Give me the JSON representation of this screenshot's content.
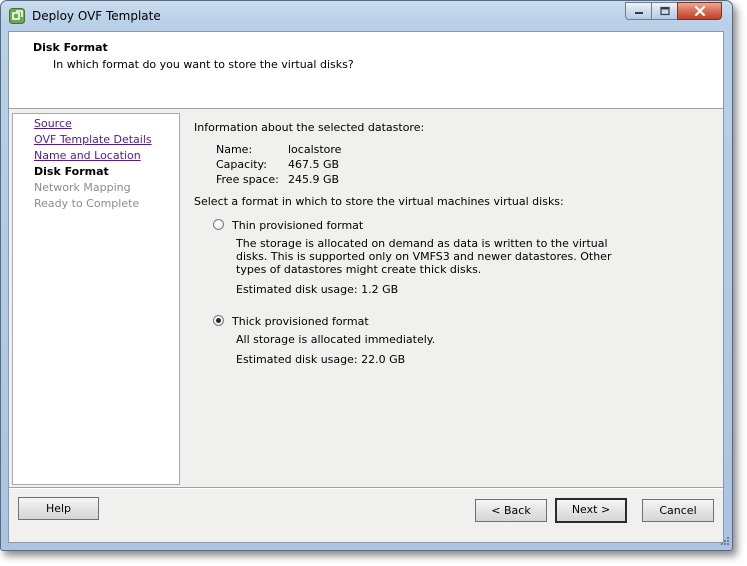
{
  "window": {
    "title": "Deploy OVF Template",
    "icon": "ovf-template-icon",
    "controls": [
      "minimize-icon",
      "maximize-icon",
      "close-icon"
    ]
  },
  "header": {
    "title": "Disk Format",
    "subtitle": "In which format do you want to store the virtual disks?"
  },
  "nav": {
    "items": [
      {
        "label": "Source",
        "state": "visited"
      },
      {
        "label": "OVF Template Details",
        "state": "visited"
      },
      {
        "label": "Name and Location",
        "state": "visited"
      },
      {
        "label": "Disk Format",
        "state": "current"
      },
      {
        "label": "Network Mapping",
        "state": "disabled"
      },
      {
        "label": "Ready to Complete",
        "state": "disabled"
      }
    ]
  },
  "datastore": {
    "heading": "Information about the selected datastore:",
    "name_label": "Name:",
    "name_value": "localstore",
    "capacity_label": "Capacity:",
    "capacity_value": "467.5 GB",
    "free_label": "Free space:",
    "free_value": "245.9 GB"
  },
  "format": {
    "prompt": "Select a format in which to store the virtual machines virtual disks:",
    "options": [
      {
        "label": "Thin provisioned format",
        "selected": false,
        "description": "The storage is allocated on demand as data is written to the virtual disks. This is supported only on VMFS3 and newer datastores. Other types of datastores might create thick disks.",
        "usage": "Estimated disk usage: 1.2 GB"
      },
      {
        "label": "Thick provisioned format",
        "selected": true,
        "description": "All storage is allocated immediately.",
        "usage": "Estimated disk usage: 22.0 GB"
      }
    ]
  },
  "buttons": {
    "help": "Help",
    "back": "< Back",
    "next": "Next >",
    "cancel": "Cancel"
  },
  "colors": {
    "link": "#551a8b",
    "disabled": "#8c8c8c",
    "panel_bg": "#f0f0ee",
    "frame": "#aac4e1"
  }
}
